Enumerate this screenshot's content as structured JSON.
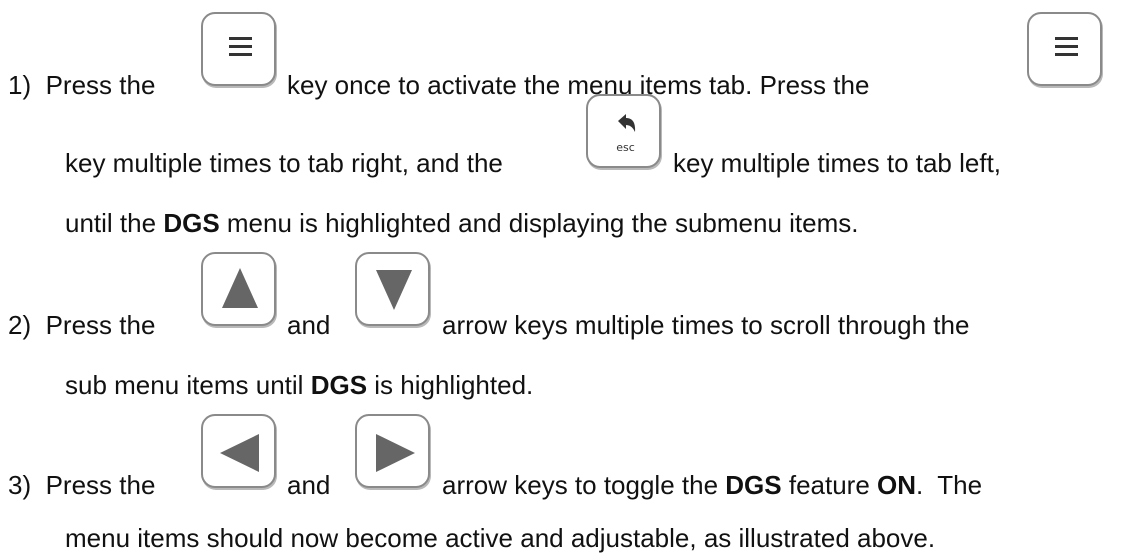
{
  "steps": [
    {
      "number": "1)",
      "line1": {
        "a": "Press the",
        "b": "key once to activate the menu items tab.  Press the"
      },
      "line2": {
        "a": "key multiple times to tab right, and the",
        "b": "key multiple times to tab left,"
      },
      "line3": {
        "a": "until the",
        "bold": "DGS",
        "b": "menu is highlighted and displaying the submenu items."
      }
    },
    {
      "number": "2)",
      "line1": {
        "a": "Press the",
        "mid": "and",
        "b": "arrow keys multiple times to scroll through the"
      },
      "line2": {
        "a": "sub menu items until",
        "bold": "DGS",
        "b": "is highlighted."
      }
    },
    {
      "number": "3)",
      "line1": {
        "a": "Press the",
        "mid": "and",
        "b": "arrow keys to toggle the",
        "bold1": "DGS",
        "c": "feature",
        "bold2": "ON",
        "d": ".  The"
      },
      "line2": {
        "text": "menu items should now become active and adjustable, as illustrated above."
      }
    }
  ],
  "keys": {
    "menu": {
      "icon": "menu-icon"
    },
    "esc": {
      "icon": "back-arrow-icon",
      "label": "esc"
    },
    "up": {
      "icon": "up-triangle-icon"
    },
    "down": {
      "icon": "down-triangle-icon"
    },
    "left": {
      "icon": "left-triangle-icon"
    },
    "right": {
      "icon": "right-triangle-icon"
    }
  },
  "colors": {
    "text": "#111111",
    "key_border": "#8a8a8a",
    "key_icon": "#555555"
  }
}
